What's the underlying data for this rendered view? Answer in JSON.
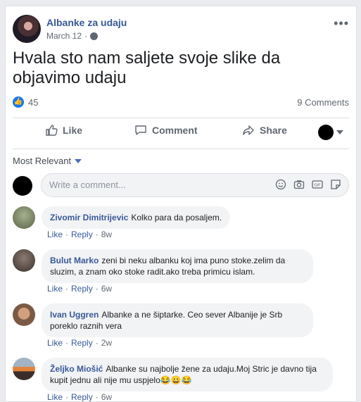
{
  "post": {
    "page_name": "Albanke za udaju",
    "date": "March 12",
    "meta_separator": "·",
    "text": "Hvala sto nam saljete svoje slike da objavimo udaju",
    "likes_count": "45",
    "comments_count": "9 Comments",
    "more_label": "•••"
  },
  "actions": {
    "like": "Like",
    "comment": "Comment",
    "share": "Share"
  },
  "comments_section": {
    "sort_label": "Most Relevant",
    "write_placeholder": "Write a comment...",
    "comments": [
      {
        "author": "Zivomir Dimitrijevic",
        "text": "Kolko para da posaljem.",
        "like": "Like",
        "reply": "Reply",
        "time": "8w"
      },
      {
        "author": "Bulut Marko",
        "text": "zeni bi neku albanku koj ima puno stoke.zelim da sluzim, a znam oko stoke radit.ako treba primicu islam.",
        "like": "Like",
        "reply": "Reply",
        "time": "6w"
      },
      {
        "author": "Ivan Uggren",
        "text": "Albanke a ne šiptarke. Ceo sever Albanije je Srb poreklo raznih vera",
        "like": "Like",
        "reply": "Reply",
        "time": "2w"
      },
      {
        "author": "Željko Miošić",
        "text": "Albanke su najbolje žene za udaju.Moj Stric je davno tija kupit jednu ali nije mu uspjelo😂😀😂",
        "like": "Like",
        "reply": "Reply",
        "time": "6w"
      }
    ]
  },
  "colors": {
    "accent_blue": "#385898",
    "like_blue": "#1877f2",
    "text_gray": "#606770"
  }
}
